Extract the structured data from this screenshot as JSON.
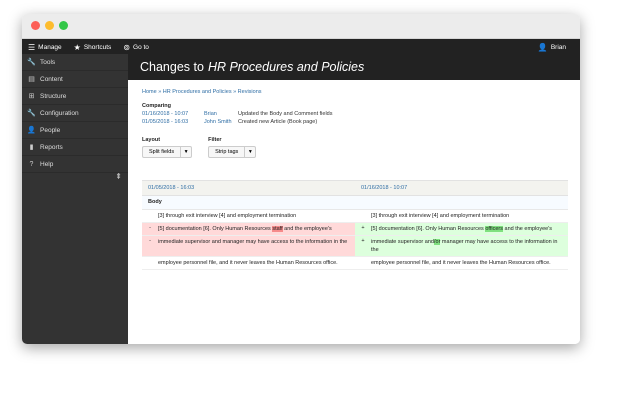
{
  "toolbar": {
    "manage": "Manage",
    "shortcuts": "Shortcuts",
    "goto": "Go to",
    "user": "Brian"
  },
  "sidebar": {
    "items": [
      {
        "label": "Tools",
        "icon": "wrench-icon"
      },
      {
        "label": "Content",
        "icon": "file-icon"
      },
      {
        "label": "Structure",
        "icon": "sitemap-icon"
      },
      {
        "label": "Configuration",
        "icon": "wrench-icon"
      },
      {
        "label": "People",
        "icon": "person-icon"
      },
      {
        "label": "Reports",
        "icon": "bar-chart-icon"
      },
      {
        "label": "Help",
        "icon": "help-icon"
      }
    ]
  },
  "header": {
    "prefix": "Changes to",
    "title": "HR Procedures and Policies"
  },
  "breadcrumb": "Home » HR Procedures and Policies » Revisions",
  "comparing": {
    "label": "Comparing",
    "rows": [
      {
        "date": "01/16/2018 - 10:07",
        "user": "Brian",
        "message": "Updated the Body and Comment fields"
      },
      {
        "date": "01/05/2018 - 16:03",
        "user": "John Smith",
        "message": "Created new Article (Book page)"
      }
    ]
  },
  "filters": {
    "layout_label": "Layout",
    "layout_value": "Split fields",
    "filter_label": "Filter",
    "filter_value": "Strip tags"
  },
  "diff": {
    "left_date": "01/05/2018 - 16:03",
    "right_date": "01/16/2018 - 10:07",
    "field": "Body",
    "rows": [
      {
        "left": "[3] through exit interview [4] and employment termination",
        "right": "[3] through exit interview [4] and employment termination"
      },
      {
        "left_a": "[5] documentation [6]. Only Human Resources ",
        "left_hl": "staff",
        "left_b": " and the employee's",
        "right_a": "[5] documentation [6]. Only Human Resources ",
        "right_hl": "officers",
        "right_b": " and the employee's"
      },
      {
        "left": "immediate supervisor and manager may have access to the information in the",
        "right_a": "immediate supervisor and",
        "right_hl": "/or",
        "right_b": " manager may have access to the information in the"
      },
      {
        "left": "employee personnel file, and it never leaves the Human Resources office.",
        "right": "employee personnel file, and it never leaves the Human Resources office."
      }
    ],
    "minus": "-",
    "plus": "+"
  }
}
